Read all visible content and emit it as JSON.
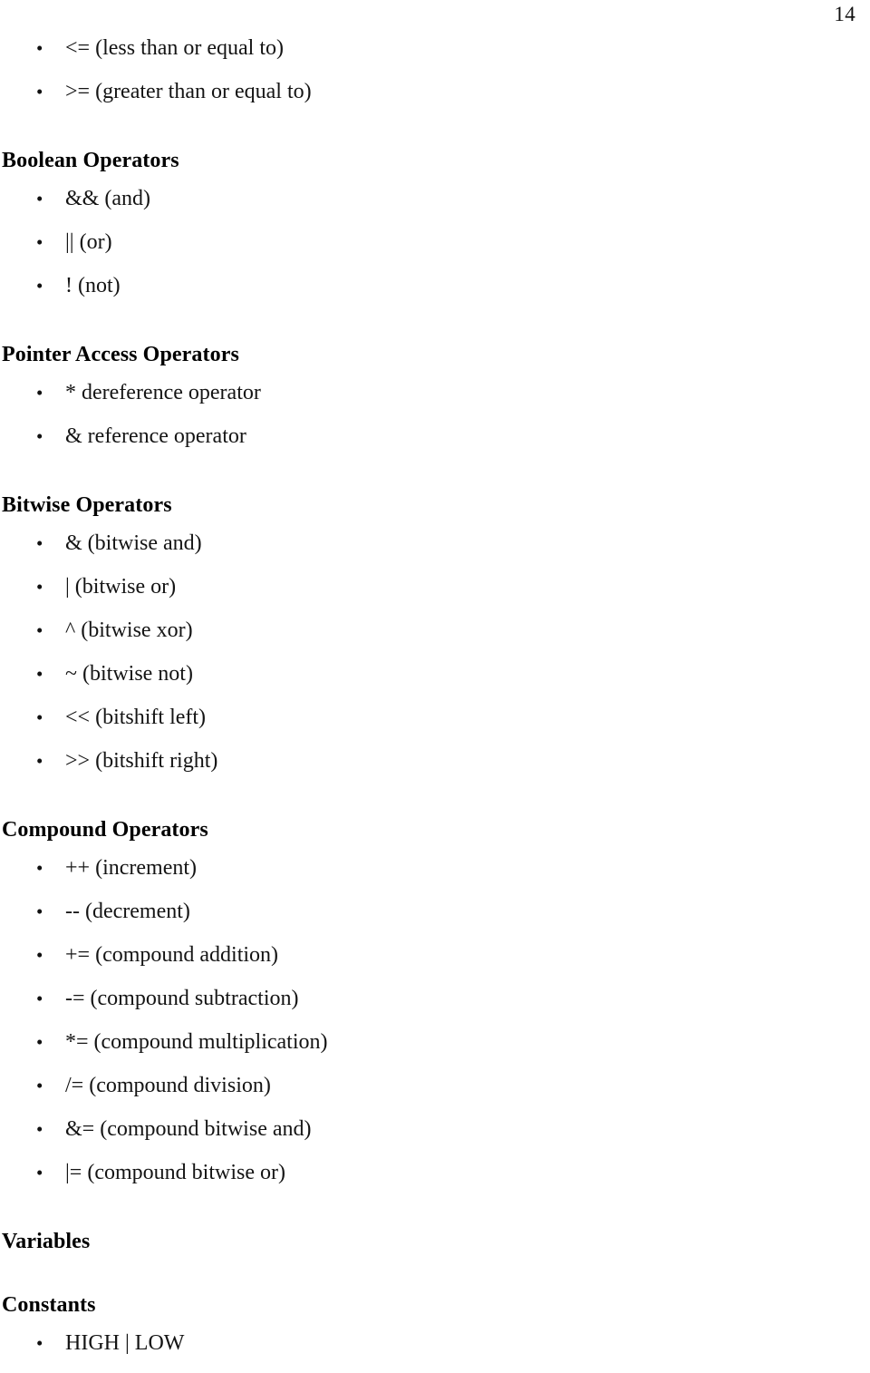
{
  "page": {
    "number": "14",
    "background_color": "#ffffff",
    "text_color": "#0d0d0d"
  },
  "bullet_glyph": "•",
  "intro_items": [
    {
      "text": "<= (less than or equal to)"
    },
    {
      "text": ">= (greater than or equal to)"
    }
  ],
  "sections": [
    {
      "heading": "Boolean Operators",
      "items": [
        {
          "text": "&& (and)"
        },
        {
          "text": "|| (or)"
        },
        {
          "text": "! (not)"
        }
      ]
    },
    {
      "heading": "Pointer Access Operators",
      "items": [
        {
          "text": "* dereference operator"
        },
        {
          "text": "& reference operator"
        }
      ]
    },
    {
      "heading": "Bitwise Operators",
      "items": [
        {
          "text": "& (bitwise and)"
        },
        {
          "text": "| (bitwise or)"
        },
        {
          "text": "^ (bitwise xor)"
        },
        {
          "text": "~ (bitwise not)"
        },
        {
          "text": "<< (bitshift left)"
        },
        {
          "text": ">> (bitshift right)"
        }
      ]
    },
    {
      "heading": "Compound Operators",
      "items": [
        {
          "text": "++ (increment)"
        },
        {
          "text": "-- (decrement)"
        },
        {
          "text": "+= (compound addition)"
        },
        {
          "text": "-= (compound subtraction)"
        },
        {
          "text": "*= (compound multiplication)"
        },
        {
          "text": "/= (compound division)"
        },
        {
          "text": "&= (compound bitwise and)"
        },
        {
          "text": "|= (compound bitwise or)"
        }
      ]
    },
    {
      "heading": "Variables",
      "items": []
    },
    {
      "heading": "Constants",
      "items": [
        {
          "text": "HIGH | LOW"
        }
      ]
    }
  ]
}
